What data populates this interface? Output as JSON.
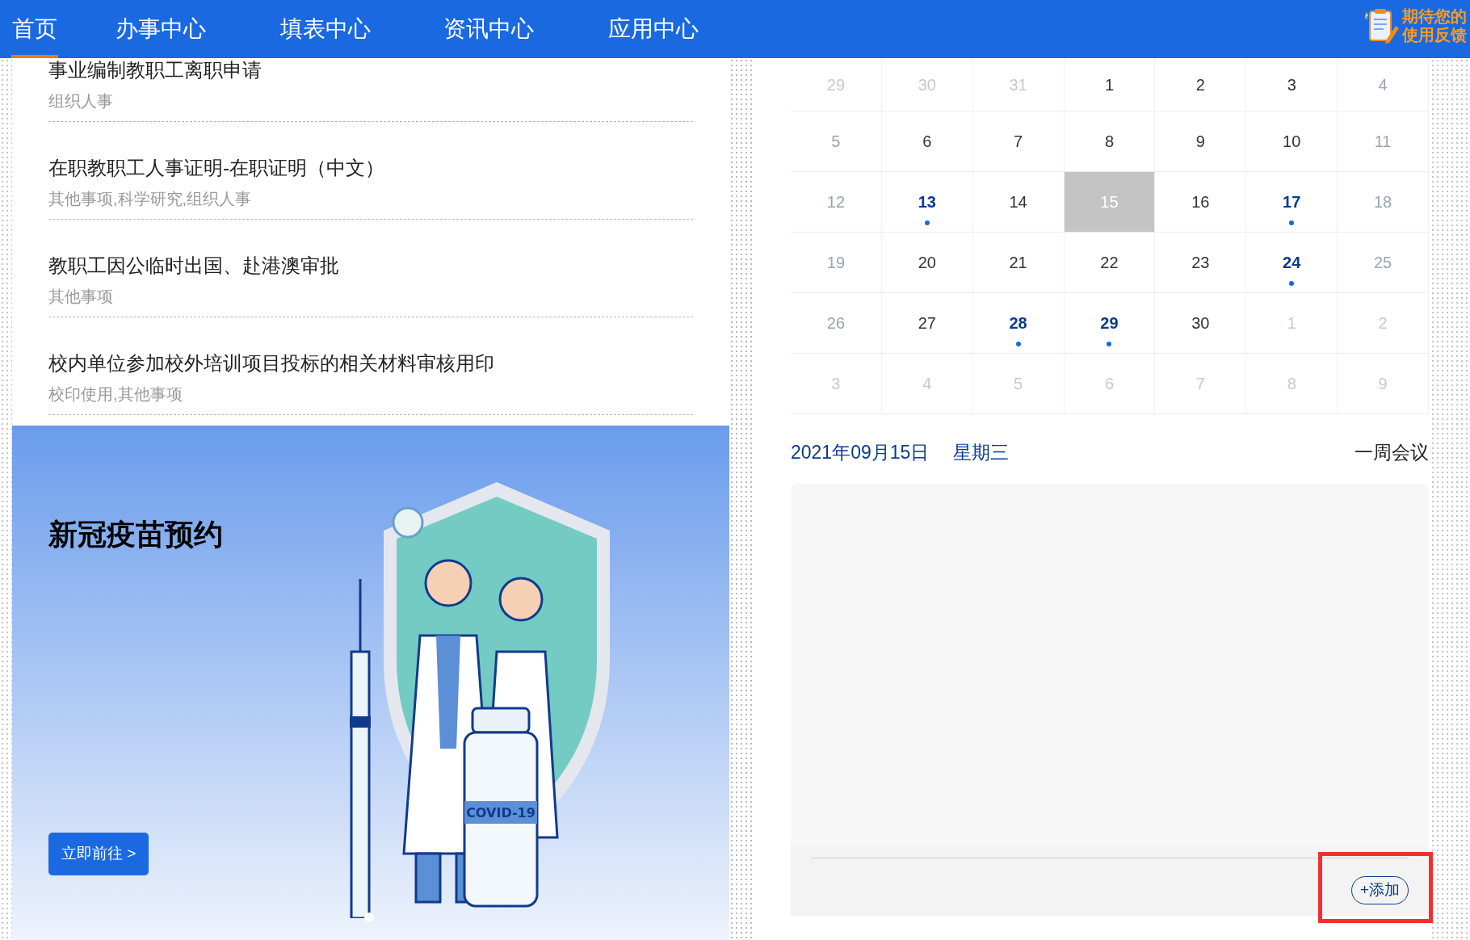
{
  "nav": {
    "tabs": [
      {
        "label": "首页",
        "selected": true
      },
      {
        "label": "办事中心",
        "selected": false
      },
      {
        "label": "填表中心",
        "selected": false
      },
      {
        "label": "资讯中心",
        "selected": false
      },
      {
        "label": "应用中心",
        "selected": false
      }
    ],
    "feedback": [
      "期待您的",
      "使用反馈"
    ]
  },
  "services": [
    {
      "title": "事业编制教职工离职申请",
      "tags": "组织人事"
    },
    {
      "title": "在职教职工人事证明-在职证明（中文）",
      "tags": "其他事项,科学研究,组织人事"
    },
    {
      "title": "教职工因公临时出国、赴港澳审批",
      "tags": "其他事项"
    },
    {
      "title": "校内单位参加校外培训项目投标的相关材料审核用印",
      "tags": "校印使用,其他事项"
    }
  ],
  "banner": {
    "title": "新冠疫苗预约",
    "button": "立即前往 >",
    "vial_label": "COVID-19",
    "slides": [
      {
        "selected": true
      }
    ]
  },
  "calendar": {
    "weeks": [
      [
        {
          "day": "29",
          "kind": "other",
          "event": false,
          "selected": false
        },
        {
          "day": "30",
          "kind": "other",
          "event": false,
          "selected": false
        },
        {
          "day": "31",
          "kind": "other",
          "event": false,
          "selected": false
        },
        {
          "day": "1",
          "kind": "weekday",
          "event": false,
          "selected": false
        },
        {
          "day": "2",
          "kind": "weekday",
          "event": false,
          "selected": false
        },
        {
          "day": "3",
          "kind": "weekday",
          "event": false,
          "selected": false
        },
        {
          "day": "4",
          "kind": "weekend",
          "event": false,
          "selected": false
        }
      ],
      [
        {
          "day": "5",
          "kind": "weekend",
          "event": false,
          "selected": false
        },
        {
          "day": "6",
          "kind": "weekday",
          "event": false,
          "selected": false
        },
        {
          "day": "7",
          "kind": "weekday",
          "event": false,
          "selected": false
        },
        {
          "day": "8",
          "kind": "weekday",
          "event": false,
          "selected": false
        },
        {
          "day": "9",
          "kind": "weekday",
          "event": false,
          "selected": false
        },
        {
          "day": "10",
          "kind": "weekday",
          "event": false,
          "selected": false
        },
        {
          "day": "11",
          "kind": "weekend",
          "event": false,
          "selected": false
        }
      ],
      [
        {
          "day": "12",
          "kind": "weekend",
          "event": false,
          "selected": false
        },
        {
          "day": "13",
          "kind": "weekday",
          "event": true,
          "selected": false
        },
        {
          "day": "14",
          "kind": "weekday",
          "event": false,
          "selected": false
        },
        {
          "day": "15",
          "kind": "weekday",
          "event": false,
          "selected": true
        },
        {
          "day": "16",
          "kind": "weekday",
          "event": false,
          "selected": false
        },
        {
          "day": "17",
          "kind": "weekday",
          "event": true,
          "selected": false
        },
        {
          "day": "18",
          "kind": "weekend",
          "event": false,
          "selected": false
        }
      ],
      [
        {
          "day": "19",
          "kind": "weekend",
          "event": false,
          "selected": false
        },
        {
          "day": "20",
          "kind": "weekday",
          "event": false,
          "selected": false
        },
        {
          "day": "21",
          "kind": "weekday",
          "event": false,
          "selected": false
        },
        {
          "day": "22",
          "kind": "weekday",
          "event": false,
          "selected": false
        },
        {
          "day": "23",
          "kind": "weekday",
          "event": false,
          "selected": false
        },
        {
          "day": "24",
          "kind": "weekday",
          "event": true,
          "selected": false
        },
        {
          "day": "25",
          "kind": "weekend",
          "event": false,
          "selected": false
        }
      ],
      [
        {
          "day": "26",
          "kind": "weekend",
          "event": false,
          "selected": false
        },
        {
          "day": "27",
          "kind": "weekday",
          "event": false,
          "selected": false
        },
        {
          "day": "28",
          "kind": "weekday",
          "event": true,
          "selected": false
        },
        {
          "day": "29",
          "kind": "weekday",
          "event": true,
          "selected": false
        },
        {
          "day": "30",
          "kind": "weekday",
          "event": false,
          "selected": false
        },
        {
          "day": "1",
          "kind": "other",
          "event": false,
          "selected": false
        },
        {
          "day": "2",
          "kind": "other",
          "event": false,
          "selected": false
        }
      ],
      [
        {
          "day": "3",
          "kind": "other",
          "event": false,
          "selected": false
        },
        {
          "day": "4",
          "kind": "other",
          "event": false,
          "selected": false
        },
        {
          "day": "5",
          "kind": "other",
          "event": false,
          "selected": false
        },
        {
          "day": "6",
          "kind": "other",
          "event": false,
          "selected": false
        },
        {
          "day": "7",
          "kind": "other",
          "event": false,
          "selected": false
        },
        {
          "day": "8",
          "kind": "other",
          "event": false,
          "selected": false
        },
        {
          "day": "9",
          "kind": "other",
          "event": false,
          "selected": false
        }
      ]
    ],
    "date": "2021年09月15日",
    "weekday": "星期三",
    "link": "一周会议",
    "add_button": "+添加",
    "add_highlighted": true
  }
}
